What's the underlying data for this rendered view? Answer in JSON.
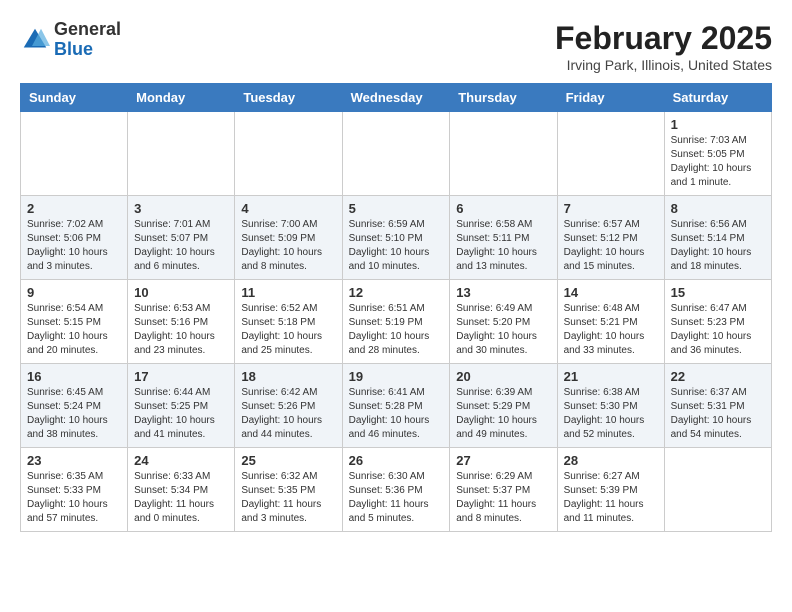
{
  "header": {
    "logo_line1": "General",
    "logo_line2": "Blue",
    "month_year": "February 2025",
    "location": "Irving Park, Illinois, United States"
  },
  "weekdays": [
    "Sunday",
    "Monday",
    "Tuesday",
    "Wednesday",
    "Thursday",
    "Friday",
    "Saturday"
  ],
  "weeks": [
    [
      {
        "day": "",
        "info": ""
      },
      {
        "day": "",
        "info": ""
      },
      {
        "day": "",
        "info": ""
      },
      {
        "day": "",
        "info": ""
      },
      {
        "day": "",
        "info": ""
      },
      {
        "day": "",
        "info": ""
      },
      {
        "day": "1",
        "info": "Sunrise: 7:03 AM\nSunset: 5:05 PM\nDaylight: 10 hours\nand 1 minute."
      }
    ],
    [
      {
        "day": "2",
        "info": "Sunrise: 7:02 AM\nSunset: 5:06 PM\nDaylight: 10 hours\nand 3 minutes."
      },
      {
        "day": "3",
        "info": "Sunrise: 7:01 AM\nSunset: 5:07 PM\nDaylight: 10 hours\nand 6 minutes."
      },
      {
        "day": "4",
        "info": "Sunrise: 7:00 AM\nSunset: 5:09 PM\nDaylight: 10 hours\nand 8 minutes."
      },
      {
        "day": "5",
        "info": "Sunrise: 6:59 AM\nSunset: 5:10 PM\nDaylight: 10 hours\nand 10 minutes."
      },
      {
        "day": "6",
        "info": "Sunrise: 6:58 AM\nSunset: 5:11 PM\nDaylight: 10 hours\nand 13 minutes."
      },
      {
        "day": "7",
        "info": "Sunrise: 6:57 AM\nSunset: 5:12 PM\nDaylight: 10 hours\nand 15 minutes."
      },
      {
        "day": "8",
        "info": "Sunrise: 6:56 AM\nSunset: 5:14 PM\nDaylight: 10 hours\nand 18 minutes."
      }
    ],
    [
      {
        "day": "9",
        "info": "Sunrise: 6:54 AM\nSunset: 5:15 PM\nDaylight: 10 hours\nand 20 minutes."
      },
      {
        "day": "10",
        "info": "Sunrise: 6:53 AM\nSunset: 5:16 PM\nDaylight: 10 hours\nand 23 minutes."
      },
      {
        "day": "11",
        "info": "Sunrise: 6:52 AM\nSunset: 5:18 PM\nDaylight: 10 hours\nand 25 minutes."
      },
      {
        "day": "12",
        "info": "Sunrise: 6:51 AM\nSunset: 5:19 PM\nDaylight: 10 hours\nand 28 minutes."
      },
      {
        "day": "13",
        "info": "Sunrise: 6:49 AM\nSunset: 5:20 PM\nDaylight: 10 hours\nand 30 minutes."
      },
      {
        "day": "14",
        "info": "Sunrise: 6:48 AM\nSunset: 5:21 PM\nDaylight: 10 hours\nand 33 minutes."
      },
      {
        "day": "15",
        "info": "Sunrise: 6:47 AM\nSunset: 5:23 PM\nDaylight: 10 hours\nand 36 minutes."
      }
    ],
    [
      {
        "day": "16",
        "info": "Sunrise: 6:45 AM\nSunset: 5:24 PM\nDaylight: 10 hours\nand 38 minutes."
      },
      {
        "day": "17",
        "info": "Sunrise: 6:44 AM\nSunset: 5:25 PM\nDaylight: 10 hours\nand 41 minutes."
      },
      {
        "day": "18",
        "info": "Sunrise: 6:42 AM\nSunset: 5:26 PM\nDaylight: 10 hours\nand 44 minutes."
      },
      {
        "day": "19",
        "info": "Sunrise: 6:41 AM\nSunset: 5:28 PM\nDaylight: 10 hours\nand 46 minutes."
      },
      {
        "day": "20",
        "info": "Sunrise: 6:39 AM\nSunset: 5:29 PM\nDaylight: 10 hours\nand 49 minutes."
      },
      {
        "day": "21",
        "info": "Sunrise: 6:38 AM\nSunset: 5:30 PM\nDaylight: 10 hours\nand 52 minutes."
      },
      {
        "day": "22",
        "info": "Sunrise: 6:37 AM\nSunset: 5:31 PM\nDaylight: 10 hours\nand 54 minutes."
      }
    ],
    [
      {
        "day": "23",
        "info": "Sunrise: 6:35 AM\nSunset: 5:33 PM\nDaylight: 10 hours\nand 57 minutes."
      },
      {
        "day": "24",
        "info": "Sunrise: 6:33 AM\nSunset: 5:34 PM\nDaylight: 11 hours\nand 0 minutes."
      },
      {
        "day": "25",
        "info": "Sunrise: 6:32 AM\nSunset: 5:35 PM\nDaylight: 11 hours\nand 3 minutes."
      },
      {
        "day": "26",
        "info": "Sunrise: 6:30 AM\nSunset: 5:36 PM\nDaylight: 11 hours\nand 5 minutes."
      },
      {
        "day": "27",
        "info": "Sunrise: 6:29 AM\nSunset: 5:37 PM\nDaylight: 11 hours\nand 8 minutes."
      },
      {
        "day": "28",
        "info": "Sunrise: 6:27 AM\nSunset: 5:39 PM\nDaylight: 11 hours\nand 11 minutes."
      },
      {
        "day": "",
        "info": ""
      }
    ]
  ]
}
